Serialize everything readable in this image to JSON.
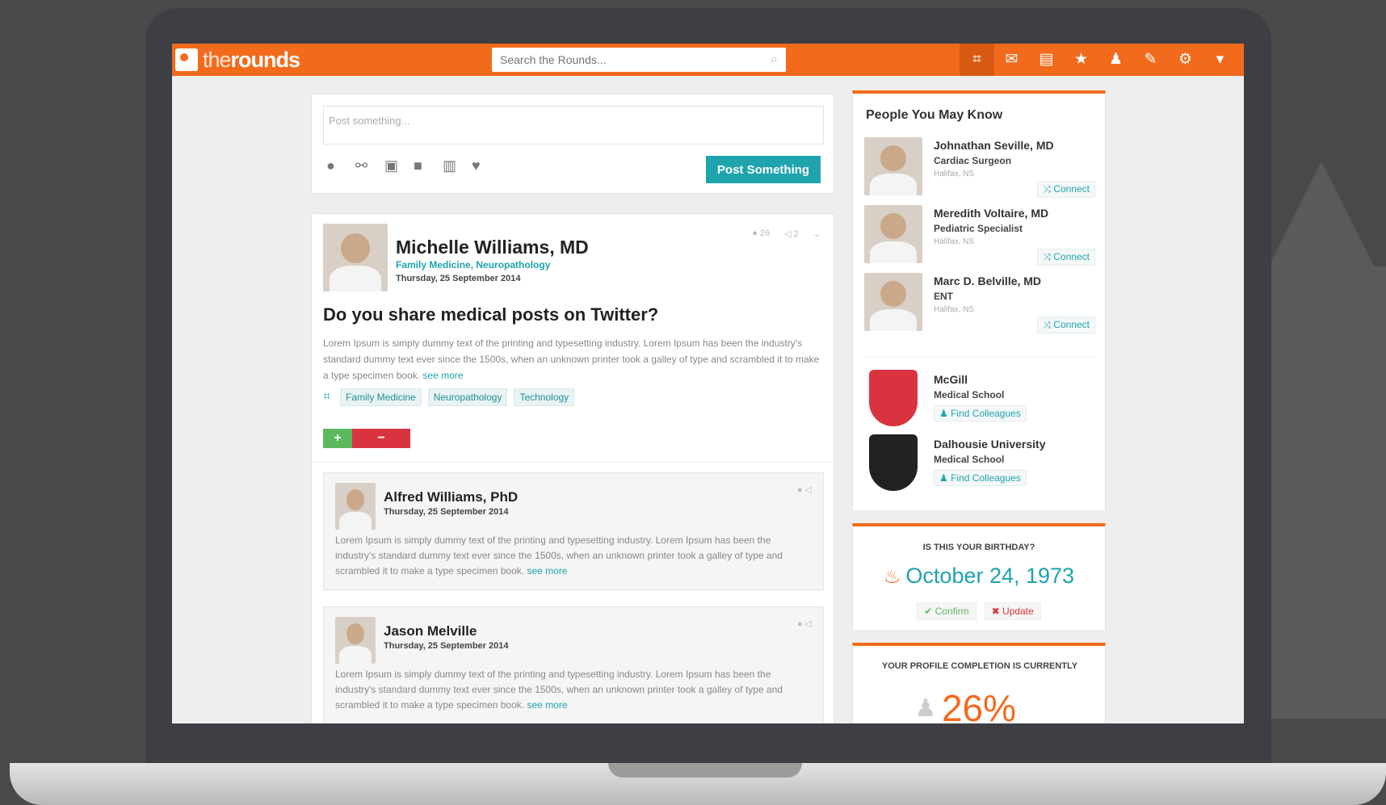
{
  "app": {
    "logo_light": "the",
    "logo_bold": "rounds",
    "search_placeholder": "Search the Rounds..."
  },
  "topbar_icons": [
    "tag-icon",
    "chat-icon",
    "mail-icon",
    "star-icon",
    "user-icon",
    "paperclip-icon",
    "gear-icon",
    "caret-down-icon"
  ],
  "composer": {
    "placeholder": "Post something...",
    "post_button": "Post Something",
    "tools": [
      "comment-icon",
      "link-icon",
      "image-icon",
      "video-icon",
      "chart-icon",
      "heart-icon"
    ]
  },
  "post": {
    "author": "Michelle Williams, MD",
    "specialty": "Family Medicine, Neuropathology",
    "date": "Thursday, 25 September 2014",
    "meta_views": "● 26",
    "meta_shares": "◁ 2",
    "title": "Do you share medical posts on Twitter?",
    "body": "Lorem Ipsum is simply dummy text of the printing and typesetting industry. Lorem Ipsum has been the industry's standard dummy text ever since the 1500s, when an unknown printer took a galley of type and scrambled it to make a type specimen book.",
    "see_more": "see more",
    "tags": [
      "Family Medicine",
      "Neuropathology",
      "Technology"
    ],
    "vote_up": "+",
    "vote_down": "−"
  },
  "comments": [
    {
      "name": "Alfred Williams, PhD",
      "date": "Thursday, 25 September 2014",
      "body": "Lorem Ipsum is simply dummy text of the printing and typesetting industry. Lorem Ipsum has been the industry's standard dummy text ever since the 1500s, when an unknown printer took a galley of type and scrambled it to make a type specimen book.",
      "see_more": "see more"
    },
    {
      "name": "Jason Melville",
      "date": "Thursday, 25 September 2014",
      "body": "Lorem Ipsum is simply dummy text of the printing and typesetting industry. Lorem Ipsum has been the industry's standard dummy text ever since the 1500s, when an unknown printer took a galley of type and scrambled it to make a type specimen book.",
      "see_more": "see more"
    }
  ],
  "people": {
    "title": "People You May Know",
    "items": [
      {
        "name": "Johnathan Seville, MD",
        "role": "Cardiac Surgeon",
        "location": "Halifax, NS",
        "action": "⤨ Connect"
      },
      {
        "name": "Meredith Voltaire, MD",
        "role": "Pediatric Specialist",
        "location": "Halifax, NS",
        "action": "⤨ Connect"
      },
      {
        "name": "Marc D. Belville, MD",
        "role": "ENT",
        "location": "Halifax, NS",
        "action": "⤨ Connect"
      }
    ],
    "schools": [
      {
        "name": "McGill",
        "sub": "Medical School",
        "action": "Find Colleagues",
        "color": "#d9333f"
      },
      {
        "name": "Dalhousie University",
        "sub": "Medical School",
        "action": "Find Colleagues",
        "color": "#222222"
      }
    ]
  },
  "birthday": {
    "question": "IS THIS YOUR BIRTHDAY?",
    "date": "October 24, 1973",
    "confirm": "✔ Confirm",
    "update": "✖ Update"
  },
  "profile": {
    "question": "YOUR PROFILE COMPLETION IS CURRENTLY",
    "percent": "26%"
  },
  "colors": {
    "brand": "#f26b1d",
    "accent": "#1fa3ad"
  }
}
